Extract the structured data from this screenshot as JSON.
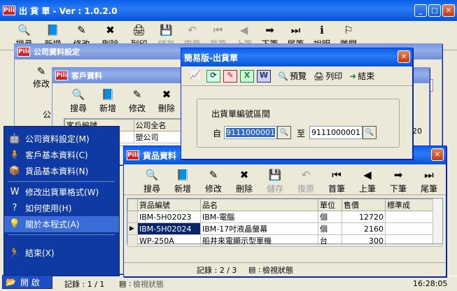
{
  "main": {
    "title": "出 貨 單 - Ver : 1.0.2.0",
    "tools": [
      {
        "icon": "magnifier-icon",
        "label": "搜尋",
        "disabled": false
      },
      {
        "icon": "book-icon",
        "label": "新增",
        "disabled": false
      },
      {
        "icon": "pen-icon",
        "label": "修改",
        "disabled": false
      },
      {
        "icon": "delete-icon",
        "label": "刪除",
        "disabled": false
      },
      {
        "icon": "printer-icon",
        "label": "列印",
        "disabled": false
      },
      {
        "icon": "save-icon",
        "label": "儲存",
        "disabled": true
      },
      {
        "icon": "undo-icon",
        "label": "復原",
        "disabled": true
      },
      {
        "icon": "first-icon",
        "label": "首筆",
        "disabled": true
      },
      {
        "icon": "prev-icon",
        "label": "上筆",
        "disabled": true
      },
      {
        "icon": "next-icon",
        "label": "下筆",
        "disabled": false
      },
      {
        "icon": "last-icon",
        "label": "尾筆",
        "disabled": false
      },
      {
        "icon": "info-icon",
        "label": "說明",
        "disabled": false
      },
      {
        "icon": "exit-icon",
        "label": "離開",
        "disabled": false
      }
    ],
    "status_record": "記錄 : 1 / 1",
    "status_mode": "檢視狀態",
    "clock": "16:28:05"
  },
  "company_win": {
    "title": "公司資料設定",
    "edit_label": "修改",
    "label_company": "公"
  },
  "customer_win": {
    "title": "客戶資料",
    "tools": [
      "搜尋",
      "新增",
      "修改",
      "刪除"
    ],
    "headers": [
      "客戶編號",
      "公司全名"
    ],
    "row_name": "塑公司",
    "col_value": "20"
  },
  "dialog": {
    "title": "簡易版-出貨單",
    "preview": "預覽",
    "print": "列印",
    "close": "結束",
    "group_label": "出貨單編號區間",
    "from_label": "自",
    "to_label": "至",
    "from_value": "9111000001",
    "to_value": "9111000001"
  },
  "goods_win": {
    "title": "貨品資料",
    "tools": [
      {
        "label": "搜尋",
        "disabled": false
      },
      {
        "label": "新增",
        "disabled": false
      },
      {
        "label": "修改",
        "disabled": false
      },
      {
        "label": "刪除",
        "disabled": false
      },
      {
        "label": "儲存",
        "disabled": true
      },
      {
        "label": "復原",
        "disabled": true
      },
      {
        "label": "首筆",
        "disabled": false
      },
      {
        "label": "上筆",
        "disabled": false
      },
      {
        "label": "下筆",
        "disabled": false
      },
      {
        "label": "尾筆",
        "disabled": false
      }
    ],
    "headers": [
      "貨品編號",
      "品名",
      "單位",
      "售價",
      "標準成"
    ],
    "rows": [
      {
        "code": "IBM-5H02023",
        "name": "IBM-電腦",
        "unit": "個",
        "price": "12720"
      },
      {
        "code": "IBM-5H02024",
        "name": "IBM-17吋液晶螢幕",
        "unit": "個",
        "price": "2160"
      },
      {
        "code": "WP-250A",
        "name": "船井來電顯示型單機",
        "unit": "台",
        "price": "300"
      }
    ],
    "status_record": "記錄 : 2 / 3",
    "status_mode": "檢視狀態"
  },
  "start_menu": {
    "items": [
      {
        "icon": "robot-icon",
        "label": "公司資料設定(M)"
      },
      {
        "icon": "person-icon",
        "label": "客戶基本資料(C)"
      },
      {
        "icon": "box-icon",
        "label": "貨品基本資料(N)"
      },
      {
        "icon": "word-icon",
        "label": "修改出貨單格式(W)"
      },
      {
        "icon": "help-icon",
        "label": "如何使用(H)"
      },
      {
        "icon": "bulb-icon",
        "label": "關於本程式(A)"
      },
      {
        "icon": "running-man-icon",
        "label": "結束(X)"
      }
    ],
    "start_label": "開 啟"
  }
}
